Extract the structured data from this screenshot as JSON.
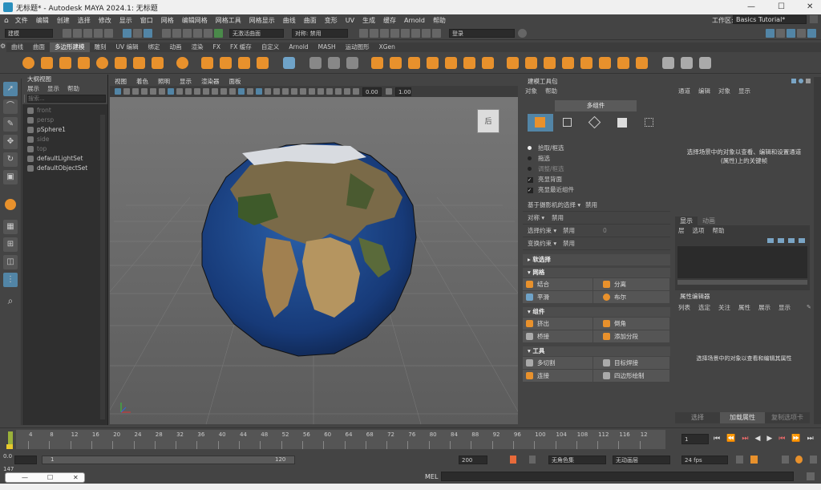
{
  "window": {
    "title": "无标题* - Autodesk MAYA 2024.1: 无标题"
  },
  "menubar": {
    "items": [
      "文件",
      "编辑",
      "创建",
      "选择",
      "修改",
      "显示",
      "窗口",
      "网格",
      "编辑网格",
      "网格工具",
      "网格显示",
      "曲线",
      "曲面",
      "变形",
      "UV",
      "生成",
      "缓存",
      "Arnold",
      "帮助"
    ],
    "workspace_label": "工作区:",
    "workspace_value": "Basics Tutorial*"
  },
  "statusline": {
    "mode": "建模",
    "live_surface": "无激活曲面",
    "symmetry_label": "对称: 禁用",
    "login": "登录"
  },
  "shelf": {
    "tabs": [
      "曲线",
      "曲面",
      "多边形建模",
      "雕刻",
      "UV 编辑",
      "绑定",
      "动画",
      "渲染",
      "FX",
      "FX 缓存",
      "自定义",
      "Arnold",
      "MASH",
      "运动图形",
      "XGen"
    ],
    "active_tab": 2,
    "colors": {
      "orange": "#e8912c",
      "blue": "#6fa3c8",
      "gray": "#aaaaaa",
      "white": "#dddddd"
    }
  },
  "outliner": {
    "title": "大纲视图",
    "menu": [
      "展示",
      "显示",
      "帮助"
    ],
    "search_placeholder": "搜索...",
    "items": [
      {
        "label": "front",
        "dim": true,
        "icon": "camera-icon"
      },
      {
        "label": "persp",
        "dim": true,
        "icon": "camera-icon"
      },
      {
        "label": "pSphere1",
        "dim": false,
        "icon": "mesh-icon"
      },
      {
        "label": "side",
        "dim": true,
        "icon": "camera-icon"
      },
      {
        "label": "top",
        "dim": true,
        "icon": "camera-icon"
      },
      {
        "label": "defaultLightSet",
        "dim": false,
        "icon": "set-icon"
      },
      {
        "label": "defaultObjectSet",
        "dim": false,
        "icon": "set-icon"
      }
    ]
  },
  "viewport": {
    "menu": [
      "视图",
      "着色",
      "照明",
      "显示",
      "渲染器",
      "面板"
    ],
    "field1": "0.00",
    "field2": "1.00",
    "viewcube_label": "后"
  },
  "toolkit": {
    "title": "建模工具包",
    "menu": [
      "对象",
      "帮助"
    ],
    "mode_button": "多组件",
    "radios": [
      "拾取/框选",
      "拖选",
      "调整/框选"
    ],
    "checks": [
      "亮显背面",
      "亮显最近组件"
    ],
    "camera_select": "基于摄影机的选择",
    "camera_select_value": "禁用",
    "symmetry": "对称",
    "symmetry_value": "禁用",
    "select_constraint": "选择约束",
    "select_constraint_value": "禁用",
    "select_constraint_num": "0",
    "transform_constraint": "变换约束",
    "transform_constraint_value": "禁用",
    "soft_select": "软选择",
    "section_mesh": "网格",
    "mesh_buttons": [
      "结合",
      "分离",
      "平滑",
      "布尔"
    ],
    "section_component": "组件",
    "component_buttons": [
      "挤出",
      "倒角",
      "桥接",
      "添加分段"
    ],
    "section_tools": "工具",
    "tool_buttons": [
      "多切割",
      "目标焊接",
      "连接",
      "四边形绘制"
    ]
  },
  "channelbox": {
    "menu": [
      "通道",
      "编辑",
      "对象",
      "显示"
    ],
    "hint": "选择场景中的对象以查看、编辑和设置通道(属性)上的关键帧",
    "layer_tabs": [
      "显示",
      "动画"
    ],
    "layer_menu": [
      "层",
      "选项",
      "帮助"
    ]
  },
  "attr_editor": {
    "title": "属性编辑器",
    "menu": [
      "列表",
      "选定",
      "关注",
      "属性",
      "展示",
      "显示"
    ],
    "hint": "选择场景中的对象以查看和编辑其属性",
    "bottom_tabs": [
      "选择",
      "加载属性",
      "复制选项卡"
    ]
  },
  "timeline": {
    "ticks": [
      "4",
      "8",
      "12",
      "16",
      "20",
      "24",
      "28",
      "32",
      "36",
      "40",
      "44",
      "48",
      "52",
      "56",
      "60",
      "64",
      "68",
      "72",
      "76",
      "80",
      "84",
      "88",
      "92",
      "96",
      "100",
      "104",
      "108",
      "112",
      "116",
      "12"
    ],
    "current_frame": "1"
  },
  "range": {
    "start": "0.0",
    "inner_start": "1",
    "inner_end": "120",
    "end": "200",
    "char_set": "无角色集",
    "anim_layer": "无动画层",
    "fps": "24 fps",
    "left_value": "147"
  },
  "cmdline": {
    "label": "MEL"
  }
}
